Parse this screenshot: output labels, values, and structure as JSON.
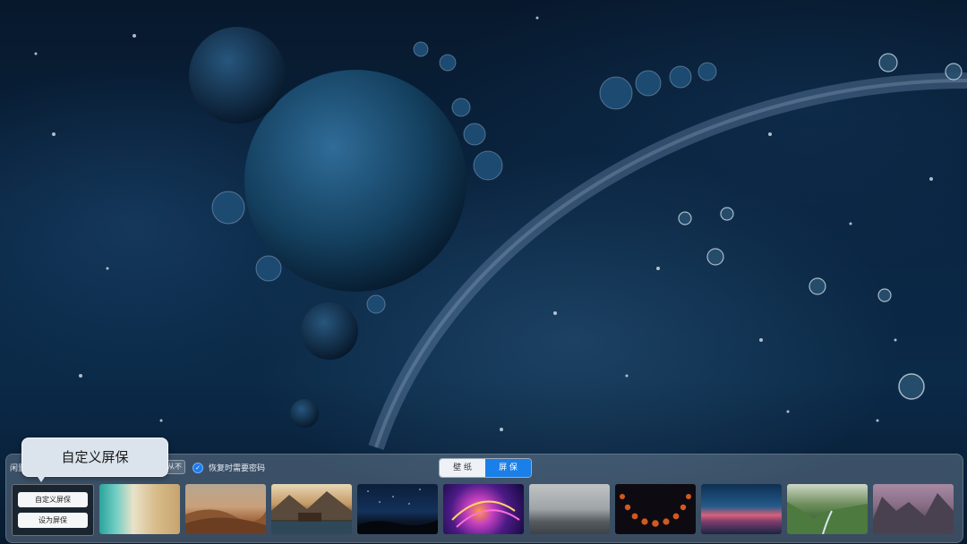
{
  "screensaver_panel": {
    "idle_label": "闲置",
    "idle_value": "从不",
    "require_password_label": "恢复时需要密码",
    "require_password_checked": true,
    "tabs": [
      {
        "label": "壁 纸",
        "active": false
      },
      {
        "label": "屏 保",
        "active": true
      }
    ],
    "custom_tile": {
      "custom_button": "自定义屏保",
      "set_button": "设为屏保"
    },
    "thumbnails": [
      {
        "icon": "aerial-beach-thumbnail"
      },
      {
        "icon": "desert-dunes-thumbnail"
      },
      {
        "icon": "mountain-lake-cabin-thumbnail"
      },
      {
        "icon": "night-sky-thumbnail"
      },
      {
        "icon": "abstract-neon-thumbnail"
      },
      {
        "icon": "foggy-sea-thumbnail"
      },
      {
        "icon": "lunar-eclipse-thumbnail"
      },
      {
        "icon": "sunset-coast-thumbnail"
      },
      {
        "icon": "green-valley-thumbnail"
      },
      {
        "icon": "yosemite-dusk-thumbnail"
      }
    ]
  },
  "tooltip": {
    "text": "自定义屏保"
  },
  "colors": {
    "accent": "#1a7fe8",
    "background": "#0a2643"
  }
}
